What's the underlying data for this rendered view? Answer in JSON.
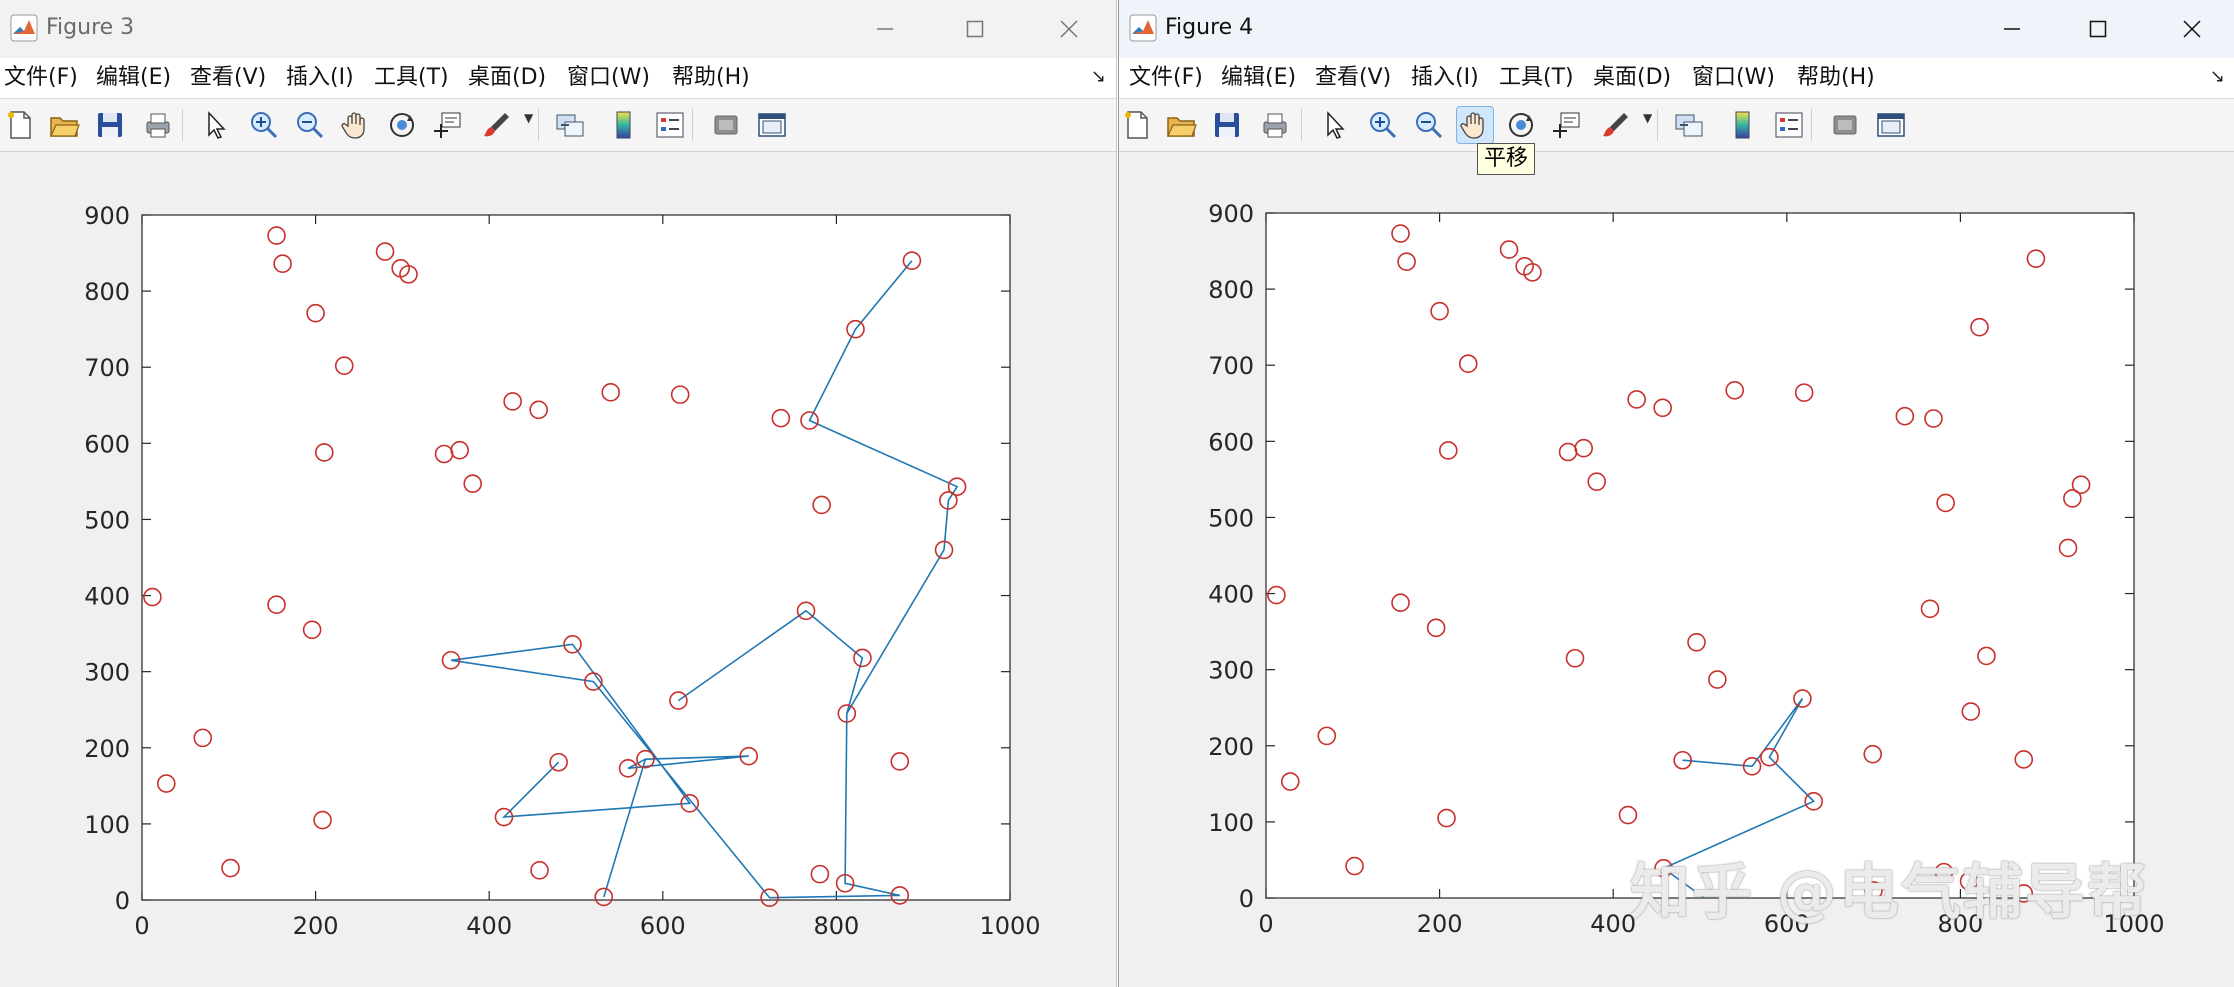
{
  "colors": {
    "marker": "#c8302c",
    "path": "#1f77b4",
    "axes": "#262626"
  },
  "menu_items": [
    "文件(F)",
    "编辑(E)",
    "查看(V)",
    "插入(I)",
    "工具(T)",
    "桌面(D)",
    "窗口(W)",
    "帮助(H)"
  ],
  "toolbar_icons": [
    "new-file-icon",
    "open-folder-icon",
    "save-icon",
    "print-icon",
    "pointer-icon",
    "zoom-in-icon",
    "zoom-out-icon",
    "pan-hand-icon",
    "rotate-3d-icon",
    "data-cursor-icon",
    "brush-icon",
    "link-plot-icon",
    "colorbar-icon",
    "legend-icon",
    "hide-plot-tools-icon",
    "show-plot-tools-icon"
  ],
  "windows": [
    {
      "title": "Figure 3"
    },
    {
      "title": "Figure 4",
      "tooltip": "平移"
    }
  ],
  "watermark": "知乎 @电气辅导帮",
  "chart_data": [
    {
      "type": "scatter",
      "figure": "Figure 3",
      "xlim": [
        0,
        1000
      ],
      "ylim": [
        0,
        900
      ],
      "xticks": [
        0,
        200,
        400,
        600,
        800,
        1000
      ],
      "yticks": [
        0,
        100,
        200,
        300,
        400,
        500,
        600,
        700,
        800,
        900
      ],
      "grid": false,
      "marker": "circle",
      "points": [
        [
          155,
          873
        ],
        [
          162,
          836
        ],
        [
          200,
          771
        ],
        [
          233,
          702
        ],
        [
          210,
          588
        ],
        [
          280,
          852
        ],
        [
          298,
          830
        ],
        [
          307,
          822
        ],
        [
          12,
          398
        ],
        [
          155,
          388
        ],
        [
          196,
          355
        ],
        [
          70,
          213
        ],
        [
          28,
          153
        ],
        [
          208,
          105
        ],
        [
          102,
          42
        ],
        [
          427,
          655
        ],
        [
          457,
          644
        ],
        [
          540,
          667
        ],
        [
          620,
          664
        ],
        [
          348,
          586
        ],
        [
          366,
          591
        ],
        [
          381,
          547
        ],
        [
          356,
          315
        ],
        [
          496,
          336
        ],
        [
          520,
          287
        ],
        [
          480,
          181
        ],
        [
          417,
          109
        ],
        [
          458,
          39
        ],
        [
          532,
          4
        ],
        [
          560,
          173
        ],
        [
          580,
          185
        ],
        [
          631,
          127
        ],
        [
          618,
          262
        ],
        [
          699,
          189
        ],
        [
          723,
          3
        ],
        [
          736,
          633
        ],
        [
          769,
          630
        ],
        [
          783,
          519
        ],
        [
          765,
          380
        ],
        [
          822,
          750
        ],
        [
          887,
          840
        ],
        [
          939,
          543
        ],
        [
          929,
          525
        ],
        [
          924,
          460
        ],
        [
          830,
          318
        ],
        [
          812,
          245
        ],
        [
          873,
          182
        ],
        [
          781,
          34
        ],
        [
          810,
          22
        ],
        [
          873,
          6
        ]
      ],
      "path": [
        [
          887,
          840
        ],
        [
          822,
          750
        ],
        [
          769,
          630
        ],
        [
          939,
          543
        ],
        [
          929,
          525
        ],
        [
          924,
          460
        ],
        [
          812,
          245
        ],
        [
          810,
          22
        ],
        [
          873,
          6
        ],
        [
          723,
          3
        ],
        [
          520,
          287
        ],
        [
          356,
          315
        ],
        [
          496,
          336
        ],
        [
          631,
          127
        ],
        [
          417,
          109
        ],
        [
          480,
          181
        ]
      ],
      "path2": [
        [
          532,
          4
        ],
        [
          580,
          185
        ],
        [
          699,
          189
        ],
        [
          560,
          173
        ],
        [
          580,
          185
        ]
      ],
      "path3": [
        [
          618,
          262
        ],
        [
          765,
          380
        ],
        [
          830,
          318
        ],
        [
          812,
          245
        ]
      ]
    },
    {
      "type": "scatter",
      "figure": "Figure 4",
      "xlim": [
        0,
        1000
      ],
      "ylim": [
        0,
        900
      ],
      "xticks": [
        0,
        200,
        400,
        600,
        800,
        1000
      ],
      "yticks": [
        0,
        100,
        200,
        300,
        400,
        500,
        600,
        700,
        800,
        900
      ],
      "grid": false,
      "marker": "circle",
      "points": [
        [
          155,
          873
        ],
        [
          162,
          836
        ],
        [
          200,
          771
        ],
        [
          233,
          702
        ],
        [
          210,
          588
        ],
        [
          280,
          852
        ],
        [
          298,
          830
        ],
        [
          307,
          822
        ],
        [
          12,
          398
        ],
        [
          155,
          388
        ],
        [
          196,
          355
        ],
        [
          70,
          213
        ],
        [
          28,
          153
        ],
        [
          208,
          105
        ],
        [
          102,
          42
        ],
        [
          427,
          655
        ],
        [
          457,
          644
        ],
        [
          540,
          667
        ],
        [
          620,
          664
        ],
        [
          348,
          586
        ],
        [
          366,
          591
        ],
        [
          381,
          547
        ],
        [
          356,
          315
        ],
        [
          496,
          336
        ],
        [
          520,
          287
        ],
        [
          480,
          181
        ],
        [
          417,
          109
        ],
        [
          458,
          39
        ],
        [
          560,
          173
        ],
        [
          580,
          185
        ],
        [
          631,
          127
        ],
        [
          618,
          262
        ],
        [
          699,
          189
        ],
        [
          736,
          633
        ],
        [
          769,
          630
        ],
        [
          783,
          519
        ],
        [
          765,
          380
        ],
        [
          822,
          750
        ],
        [
          887,
          840
        ],
        [
          939,
          543
        ],
        [
          929,
          525
        ],
        [
          924,
          460
        ],
        [
          830,
          318
        ],
        [
          812,
          245
        ],
        [
          873,
          182
        ],
        [
          781,
          34
        ],
        [
          810,
          22
        ],
        [
          873,
          6
        ],
        [
          700,
          10
        ]
      ],
      "path": [
        [
          618,
          262
        ],
        [
          560,
          173
        ],
        [
          480,
          181
        ]
      ],
      "path2": [
        [
          618,
          262
        ],
        [
          580,
          185
        ],
        [
          631,
          127
        ],
        [
          458,
          39
        ],
        [
          505,
          0
        ]
      ]
    }
  ]
}
